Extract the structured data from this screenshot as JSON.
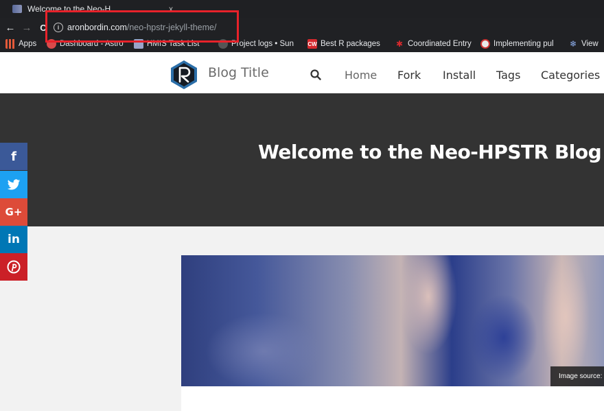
{
  "browser": {
    "tab_title": "Welcome to the Neo-H",
    "tab_close": "x",
    "back_glyph": "←",
    "forward_glyph": "→",
    "reload_glyph": "C",
    "url_host": "aronbordin.com",
    "url_path": "/neo-hpstr-jekyll-theme/"
  },
  "bookmarks": [
    {
      "label": "Apps",
      "icon": "apps-grid-icon",
      "color": "#e35a3a"
    },
    {
      "label": "Dashboard - Astro",
      "icon": "astro-icon",
      "color": "#d94a4a"
    },
    {
      "label": "HMIS Task List",
      "icon": "tasklist-icon",
      "color": "#9aa4c9"
    },
    {
      "label": "Project logs • Sun",
      "icon": "sun-icon",
      "color": "#666"
    },
    {
      "label": "Best R packages",
      "icon": "cw-icon",
      "color": "#d6292d"
    },
    {
      "label": "Coordinated Entry",
      "icon": "spider-icon",
      "color": "#d6292d"
    },
    {
      "label": "Implementing pul",
      "icon": "circle-logo-icon",
      "color": "#e9e9e9"
    },
    {
      "label": "View",
      "icon": "snowflake-icon",
      "color": "#4a74c9"
    }
  ],
  "site": {
    "blog_title": "Blog Title",
    "nav": [
      "Home",
      "Fork",
      "Install",
      "Tags",
      "Categories"
    ],
    "hero_title": "Welcome to the Neo-HPSTR Blog",
    "image_source": "Image source: c"
  },
  "social": [
    {
      "glyph": "f",
      "name": "facebook",
      "color": "#3b5998"
    },
    {
      "glyph": "🐦",
      "name": "twitter",
      "color": "#1da1f2"
    },
    {
      "glyph": "G+",
      "name": "google-plus",
      "color": "#dd4b39"
    },
    {
      "glyph": "in",
      "name": "linkedin",
      "color": "#0077b5"
    },
    {
      "glyph": "P",
      "name": "pinterest",
      "color": "#cb2027"
    }
  ],
  "colors": {
    "annotation_red": "#e8222a",
    "hero_bg": "#333333"
  }
}
